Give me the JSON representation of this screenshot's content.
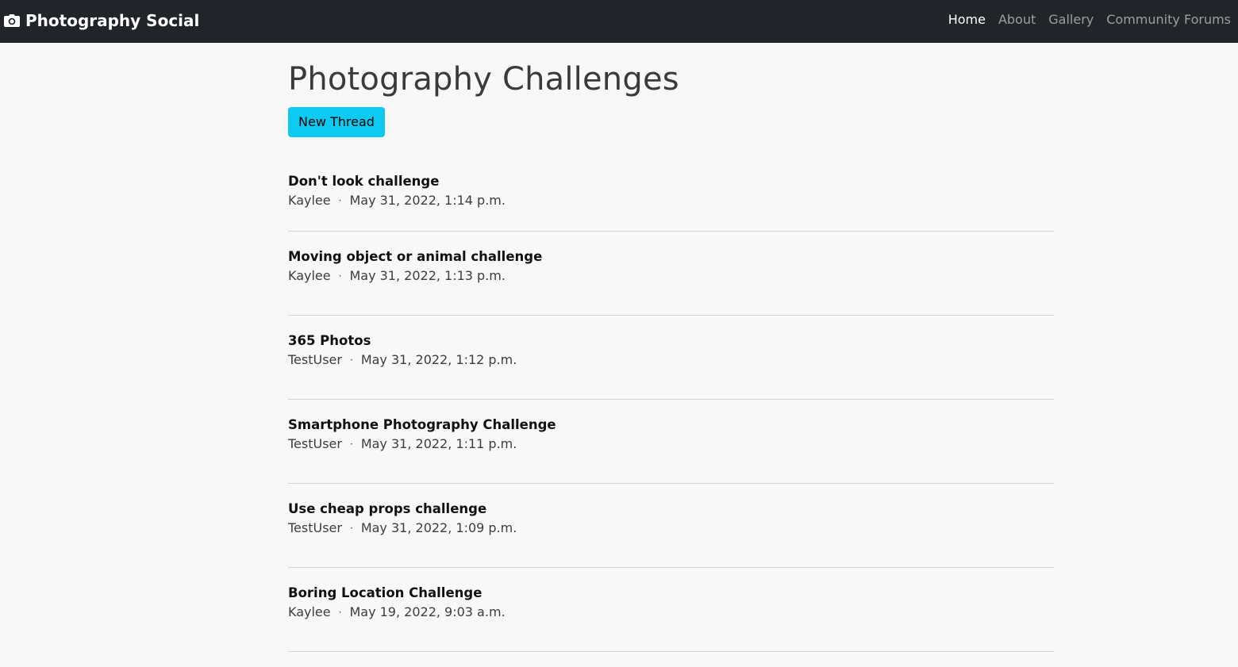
{
  "navbar": {
    "brand": "Photography Social",
    "brand_icon": "camera-icon",
    "links": [
      {
        "label": "Home",
        "active": true
      },
      {
        "label": "About",
        "active": false
      },
      {
        "label": "Gallery",
        "active": false
      },
      {
        "label": "Community Forums",
        "active": false
      }
    ]
  },
  "page": {
    "title": "Photography Challenges",
    "new_thread_label": "New Thread",
    "separator": "·"
  },
  "threads": [
    {
      "title": "Don't look challenge",
      "author": "Kaylee",
      "date": "May 31, 2022, 1:14 p.m."
    },
    {
      "title": "Moving object or animal challenge",
      "author": "Kaylee",
      "date": "May 31, 2022, 1:13 p.m."
    },
    {
      "title": "365 Photos",
      "author": "TestUser",
      "date": "May 31, 2022, 1:12 p.m."
    },
    {
      "title": "Smartphone Photography Challenge",
      "author": "TestUser",
      "date": "May 31, 2022, 1:11 p.m."
    },
    {
      "title": "Use cheap props challenge",
      "author": "TestUser",
      "date": "May 31, 2022, 1:09 p.m."
    },
    {
      "title": "Boring Location Challenge",
      "author": "Kaylee",
      "date": "May 19, 2022, 9:03 a.m."
    }
  ],
  "colors": {
    "navbar_bg": "#212529",
    "button_bg": "#0dcaf0",
    "page_bg": "#f8f8f8"
  }
}
